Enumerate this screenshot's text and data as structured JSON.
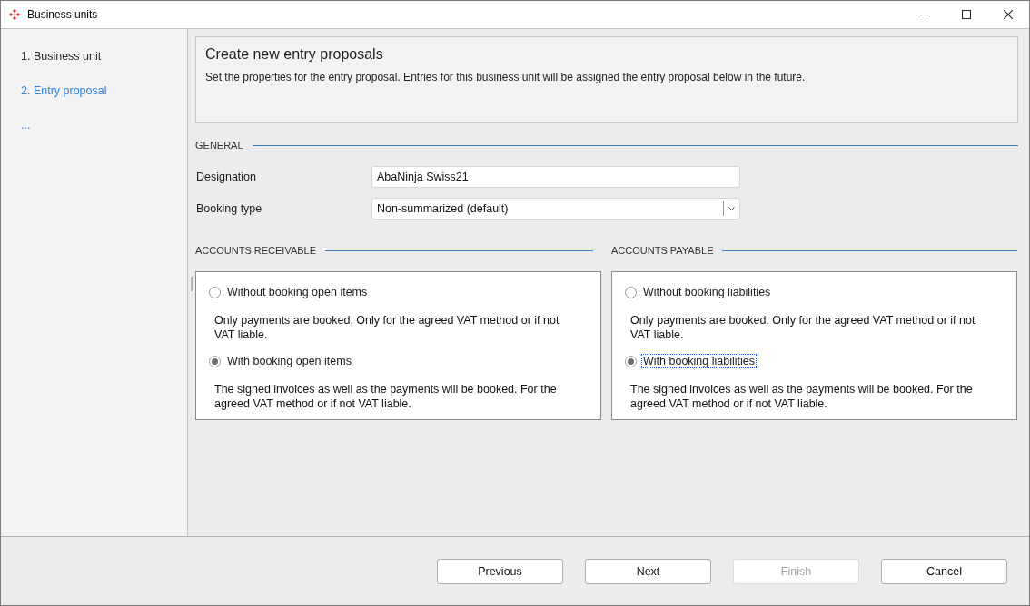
{
  "window": {
    "title": "Business units"
  },
  "steps": [
    {
      "label": "1. Business unit",
      "selected": false
    },
    {
      "label": "2. Entry proposal",
      "selected": true
    }
  ],
  "steps_more": "...",
  "header": {
    "title": "Create new entry proposals",
    "description": "Set the properties for the entry proposal. Entries for this business unit will be assigned the entry proposal below in the future."
  },
  "general": {
    "heading": "GENERAL",
    "fields": [
      {
        "kind": "text",
        "label": "Designation",
        "value": "AbaNinja Swiss21"
      },
      {
        "kind": "dropdown",
        "label": "Booking type",
        "value": "Non-summarized (default)"
      }
    ]
  },
  "groups": [
    {
      "heading": "ACCOUNTS RECEIVABLE",
      "options": [
        {
          "label": "Without booking open items",
          "selected": false,
          "focused": false,
          "description": "Only payments are booked. Only for the agreed VAT method or if not VAT liable."
        },
        {
          "label": "With booking open items",
          "selected": true,
          "focused": false,
          "description": "The signed invoices as well as the payments will be booked. For the agreed VAT method or if not VAT liable."
        }
      ]
    },
    {
      "heading": "ACCOUNTS PAYABLE",
      "options": [
        {
          "label": "Without booking liabilities",
          "selected": false,
          "focused": false,
          "description": "Only payments are booked. Only for the agreed VAT method or if not VAT liable."
        },
        {
          "label": "With booking liabilities",
          "selected": true,
          "focused": true,
          "description": "The signed invoices as well as the payments will be booked. For the agreed VAT method or if not VAT liable."
        }
      ]
    }
  ],
  "buttons": [
    {
      "label": "Previous",
      "disabled": false
    },
    {
      "label": "Next",
      "disabled": false
    },
    {
      "label": "Finish",
      "disabled": true
    },
    {
      "label": "Cancel",
      "disabled": false
    }
  ]
}
